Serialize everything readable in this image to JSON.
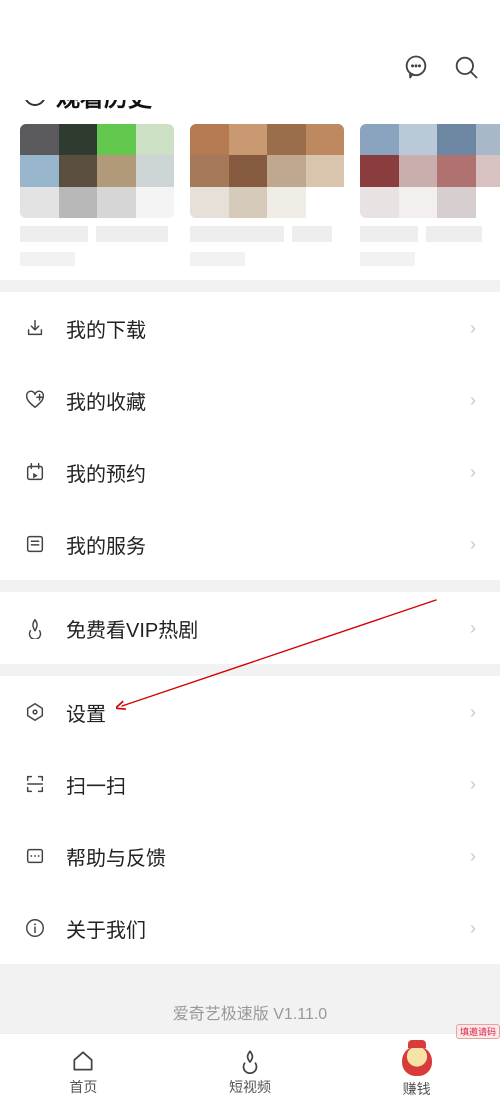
{
  "header": {
    "icons": {
      "chat": "chat-icon",
      "search": "search-icon"
    }
  },
  "section_title": "观看历史",
  "menu": {
    "group1": [
      {
        "key": "download",
        "label": "我的下载"
      },
      {
        "key": "favorite",
        "label": "我的收藏"
      },
      {
        "key": "reservation",
        "label": "我的预约"
      },
      {
        "key": "service",
        "label": "我的服务"
      }
    ],
    "group2": [
      {
        "key": "vip_free",
        "label": "免费看VIP热剧"
      }
    ],
    "group3": [
      {
        "key": "settings",
        "label": "设置"
      },
      {
        "key": "scan",
        "label": "扫一扫"
      },
      {
        "key": "help",
        "label": "帮助与反馈"
      },
      {
        "key": "about",
        "label": "关于我们"
      }
    ]
  },
  "footer": {
    "version_text": "爱奇艺极速版 V1.11.0"
  },
  "tabs": {
    "home": "首页",
    "short_video": "短视频",
    "earn": "赚钱",
    "earn_tag": "填邀请码"
  }
}
